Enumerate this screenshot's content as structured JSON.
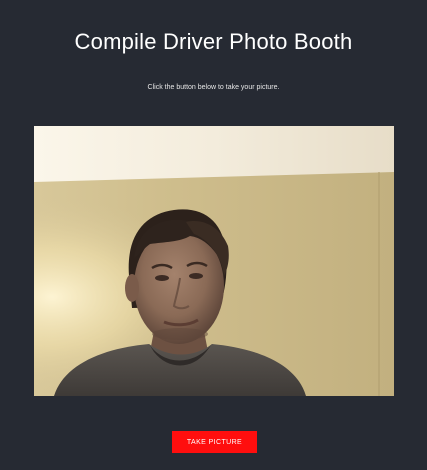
{
  "header": {
    "title": "Compile Driver Photo Booth",
    "instructions": "Click the button below to take your picture."
  },
  "camera": {
    "feed": "live-webcam-preview"
  },
  "actions": {
    "take_picture_label": "TAKE PICTURE"
  },
  "colors": {
    "background": "#262a33",
    "title_text": "#ffffff",
    "button_background": "#ff0e0e",
    "button_text": "#ffffff"
  }
}
